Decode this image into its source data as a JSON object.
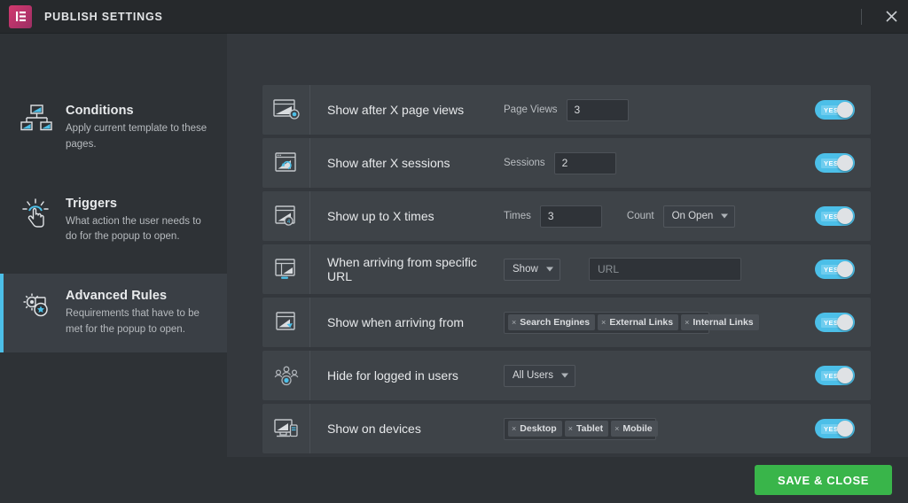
{
  "header": {
    "logo_icon": "elementor-logo-icon",
    "title": "PUBLISH SETTINGS",
    "close_icon": "close-icon"
  },
  "sidebar": {
    "items": [
      {
        "icon": "sitemap-icon",
        "title": "Conditions",
        "desc": "Apply current template to these pages.",
        "active": false
      },
      {
        "icon": "click-hand-icon",
        "title": "Triggers",
        "desc": "What action the user needs to do for the popup to open.",
        "active": false
      },
      {
        "icon": "gear-star-icon",
        "title": "Advanced Rules",
        "desc": "Requirements that have to be met for the popup to open.",
        "active": true
      }
    ]
  },
  "main": {
    "rules": [
      {
        "icon": "page-views-icon",
        "label": "Show after X page views",
        "field_label": "Page Views",
        "input_value": "3",
        "toggle": "YES",
        "toggle_on": true
      },
      {
        "icon": "sessions-icon",
        "label": "Show after X sessions",
        "field_label": "Sessions",
        "input_value": "2",
        "toggle": "YES",
        "toggle_on": true
      },
      {
        "icon": "times-icon",
        "label": "Show up to X times",
        "field_label": "Times",
        "input_value": "3",
        "second_label": "Count",
        "select_value": "On Open",
        "toggle": "YES",
        "toggle_on": true
      },
      {
        "icon": "url-icon",
        "label": "When arriving from specific URL",
        "select_value": "Show",
        "input_placeholder": "URL",
        "input_value": "",
        "toggle": "YES",
        "toggle_on": true
      },
      {
        "icon": "arriving-from-icon",
        "label": "Show when arriving from",
        "tags": [
          "Search Engines",
          "External Links",
          "Internal Links"
        ],
        "toggle": "YES",
        "toggle_on": true
      },
      {
        "icon": "users-group-icon",
        "label": "Hide for logged in users",
        "select_value": "All Users",
        "toggle": "YES",
        "toggle_on": true
      },
      {
        "icon": "devices-icon",
        "label": "Show on devices",
        "tags": [
          "Desktop",
          "Tablet",
          "Mobile"
        ],
        "toggle": "YES",
        "toggle_on": true
      }
    ]
  },
  "footer": {
    "save_label": "SAVE & CLOSE"
  },
  "colors": {
    "accent": "#4cbfe8",
    "save_green": "#39b54a",
    "header_bg": "#26292c",
    "sidebar_bg": "#2e3236",
    "main_bg": "#34383d",
    "row_bg": "#3e4348"
  }
}
